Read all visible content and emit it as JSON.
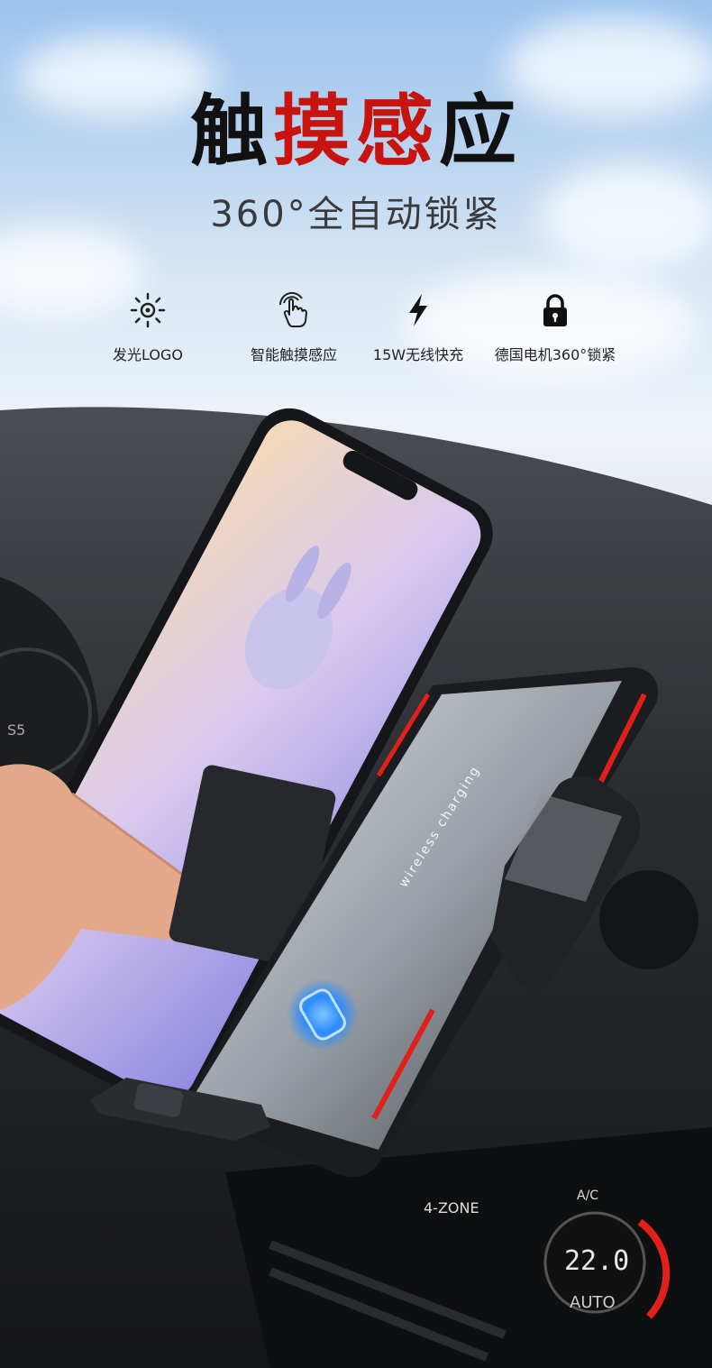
{
  "header": {
    "title_part1": "触",
    "title_part2": "摸",
    "title_part3": "感",
    "title_part4": "应",
    "subtitle": "360°全自动锁紧"
  },
  "features": [
    {
      "icon": "sun-icon",
      "label": "发光LOGO"
    },
    {
      "icon": "touch-hand-icon",
      "label": "智能触摸感应"
    },
    {
      "icon": "lightning-icon",
      "label": "15W无线快充"
    },
    {
      "icon": "lock-icon",
      "label": "德国电机360°锁紧"
    }
  ],
  "product": {
    "holder_text": "wireless charging",
    "climate_zone": "4-ZONE",
    "climate_ac": "A/C",
    "climate_temp": "22.0",
    "climate_mode": "AUTO",
    "dash_gauge": "S5"
  },
  "colors": {
    "title_dark": "#111111",
    "title_red": "#c8140f",
    "accent_red": "#e0201a",
    "touch_blue": "#2a8cff"
  }
}
